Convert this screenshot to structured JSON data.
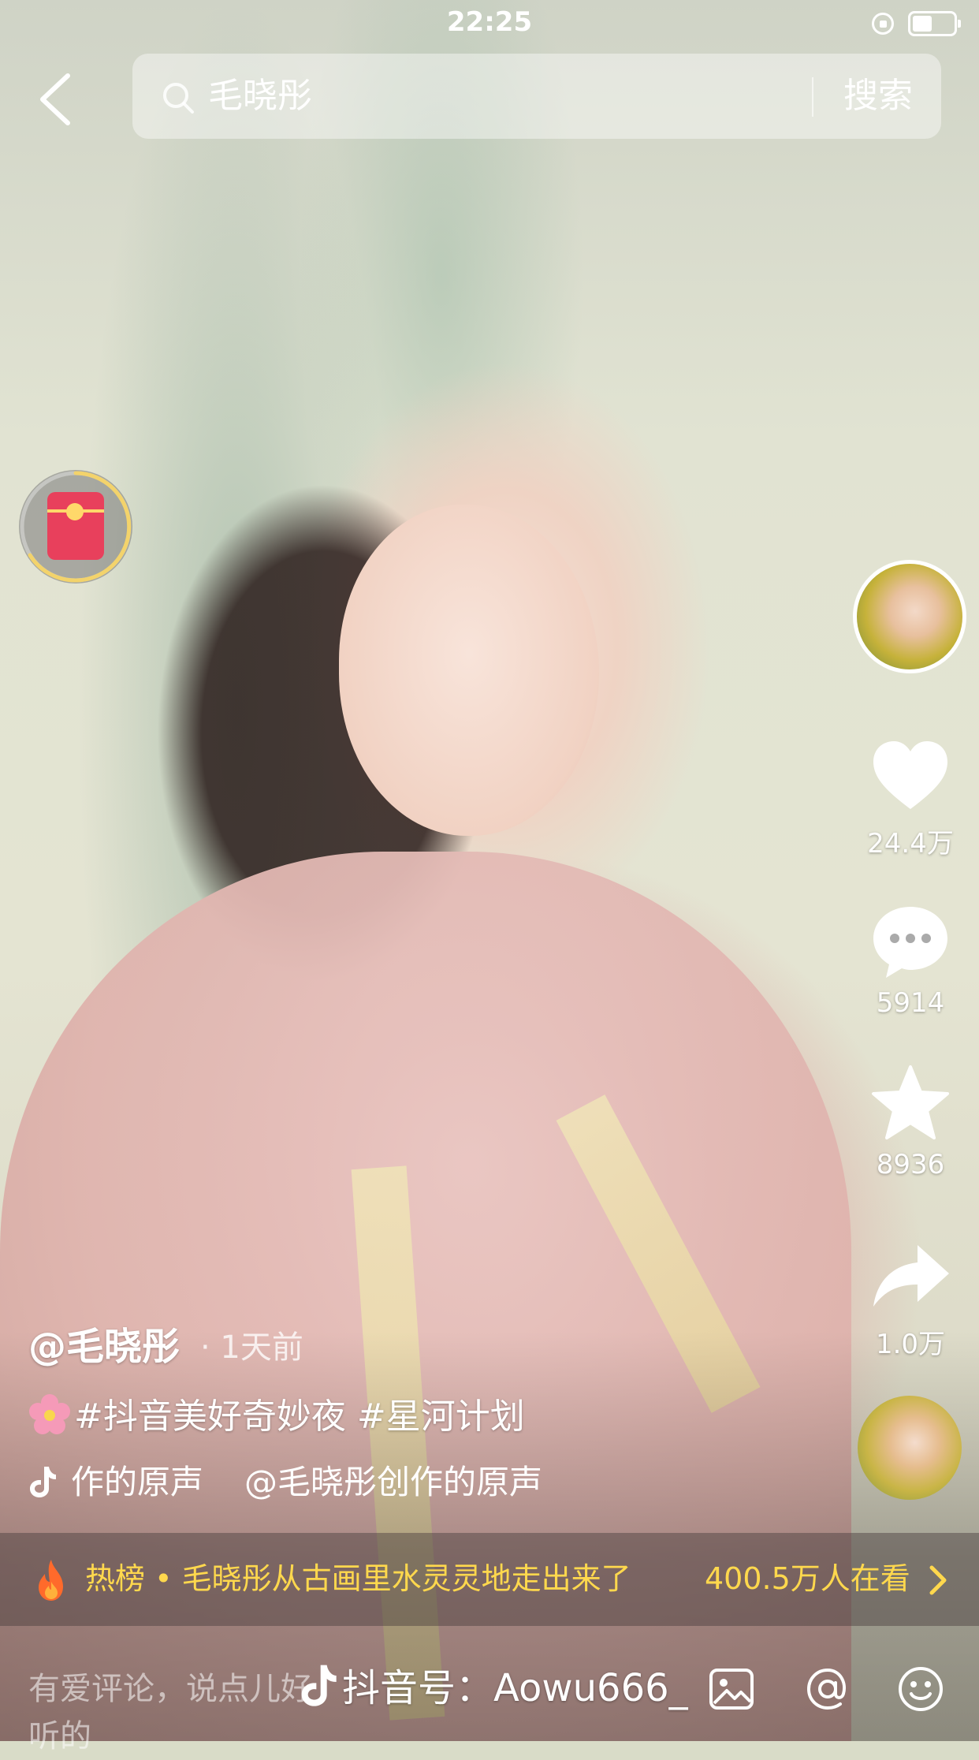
{
  "status_bar": {
    "time": "22:25",
    "icons": [
      "rotation-lock-icon",
      "battery-icon"
    ]
  },
  "search": {
    "query": "毛晓彤",
    "button_label": "搜索",
    "icons": [
      "chevron-left-icon",
      "search-icon"
    ]
  },
  "actions": {
    "likes": "24.4万",
    "comments": "5914",
    "favorites": "8936",
    "shares": "1.0万",
    "icons": [
      "heart-icon",
      "comment-icon",
      "star-icon",
      "share-icon"
    ]
  },
  "caption": {
    "username": "@毛晓彤",
    "time": "· 1天前",
    "hashtags": [
      "#抖音美好奇妙夜",
      "#星河计划"
    ],
    "music_part1": "作的原声",
    "music_part2": "@毛晓彤创作的原声"
  },
  "hot_list": {
    "text": "热榜 • 毛晓彤从古画里水灵灵地走出来了",
    "viewers": "400.5万人在看"
  },
  "comment_bar": {
    "placeholder": "有爱评论，说点儿好听的",
    "watermark": "抖音号：Aowu666_",
    "icons": [
      "image-icon",
      "at-icon",
      "emoji-icon"
    ]
  },
  "colors": {
    "hot_text": "#ffd84d",
    "red_packet": "#e8405c",
    "white": "#ffffff"
  }
}
